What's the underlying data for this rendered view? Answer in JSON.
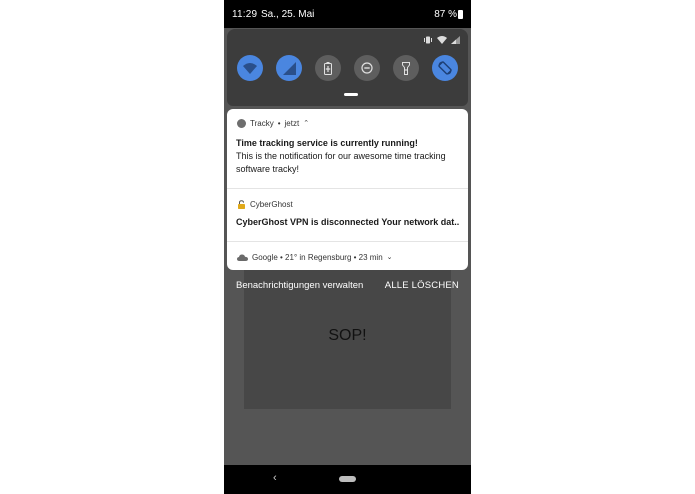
{
  "status_bar": {
    "time": "11:29",
    "date": "Sa., 25. Mai",
    "battery": "87 %"
  },
  "quick_settings": {
    "tiles": [
      {
        "name": "wifi",
        "state": "on",
        "icon": "wifi-icon"
      },
      {
        "name": "mobile-data",
        "state": "on",
        "icon": "signal-icon"
      },
      {
        "name": "battery-saver",
        "state": "off",
        "icon": "battery-saver-icon"
      },
      {
        "name": "do-not-disturb",
        "state": "off",
        "icon": "dnd-icon"
      },
      {
        "name": "flashlight",
        "state": "off",
        "icon": "flashlight-icon"
      },
      {
        "name": "auto-rotate",
        "state": "on",
        "icon": "rotate-icon"
      }
    ],
    "colors": {
      "on": "#4a86e0",
      "off": "#5e5e5e",
      "panel": "#3c3c3c"
    }
  },
  "notifications": {
    "tracky": {
      "app": "Tracky",
      "time": "jetzt",
      "title": "Time tracking service is currently running!",
      "body": "This is the notification for our awesome time tracking software tracky!"
    },
    "cyberghost": {
      "app": "CyberGhost",
      "text": "CyberGhost VPN is disconnected Your network dat.."
    },
    "google": {
      "summary": "Google • 21° in Regensburg • 23 min"
    }
  },
  "actions": {
    "manage": "Benachrichtigungen verwalten",
    "clear_all": "ALLE LÖSCHEN"
  },
  "app": {
    "text": "SOP!"
  }
}
